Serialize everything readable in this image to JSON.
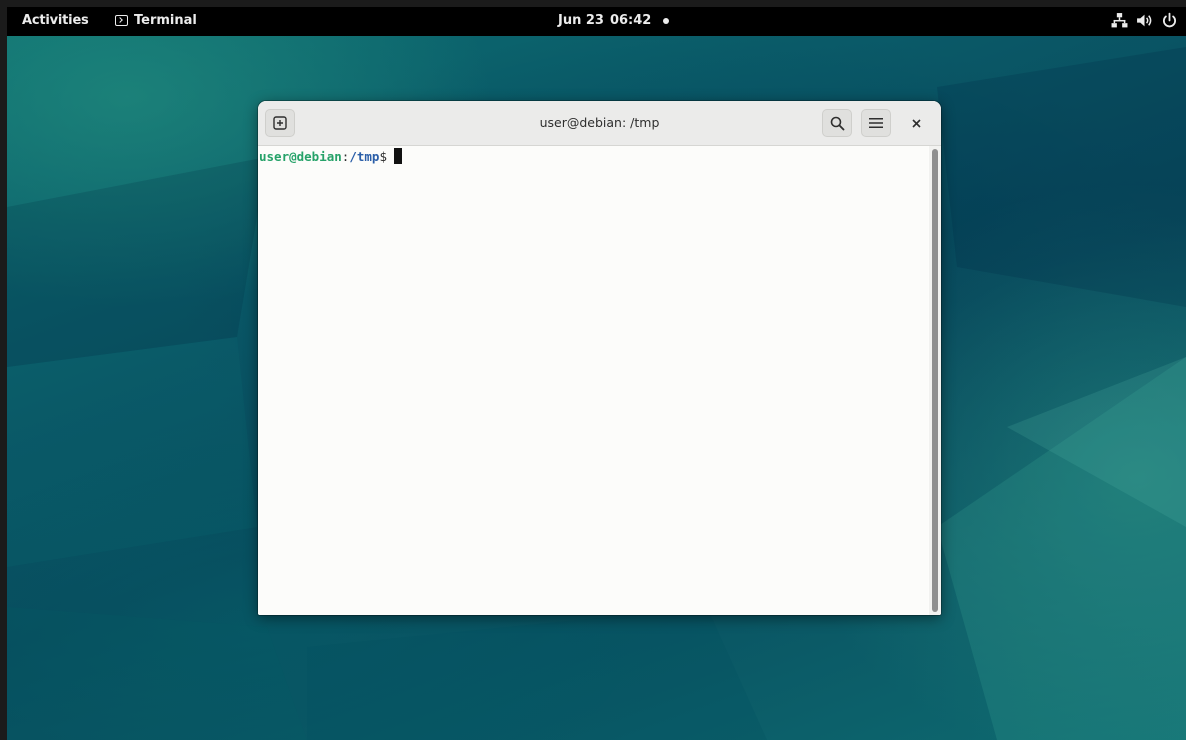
{
  "topbar": {
    "activities_label": "Activities",
    "app_name": "Terminal",
    "app_icon": "terminal-icon",
    "date": "Jun 23",
    "time": "06:42",
    "tray_icons": [
      "network-icon",
      "volume-icon",
      "power-icon"
    ]
  },
  "window": {
    "title": "user@debian: /tmp",
    "buttons": [
      "new-tab-icon",
      "search-icon",
      "hamburger-menu-icon",
      "close-icon"
    ]
  },
  "terminal": {
    "prompt_user": "user@debian",
    "prompt_sep": ":",
    "prompt_path": "/tmp",
    "prompt_symbol": "$"
  },
  "colors": {
    "prompt_user": "#26a269",
    "prompt_path": "#2a5ea8",
    "topbar": "#000000",
    "terminal_bg": "#fcfcfa",
    "headerbar": "#ebebea"
  }
}
